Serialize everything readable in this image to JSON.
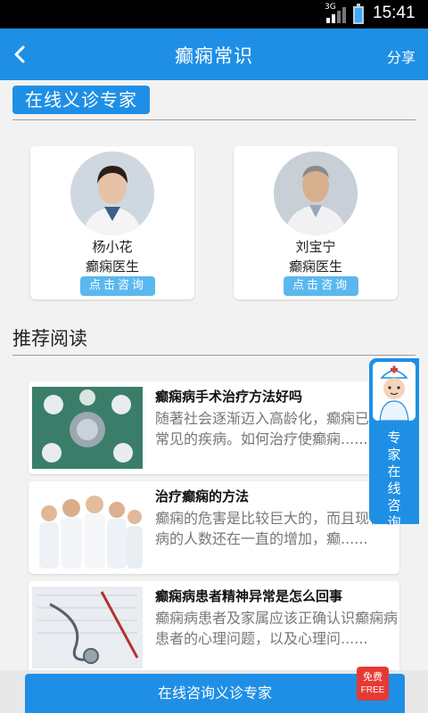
{
  "status_bar": {
    "network": "3G",
    "time": "15:41"
  },
  "app_bar": {
    "title": "癫痫常识",
    "share_label": "分享"
  },
  "experts_section": {
    "label": "在线义诊专家"
  },
  "doctors": [
    {
      "name": "杨小花",
      "role": "癫痫医生",
      "consult_label": "点击咨询"
    },
    {
      "name": "刘宝宁",
      "role": "癫痫医生",
      "consult_label": "点击咨询"
    }
  ],
  "reading_section": {
    "title": "推荐阅读"
  },
  "articles": [
    {
      "title": "癫痫病手术治疗方法好吗",
      "summary": "随著社会逐渐迈入高龄化，癫痫已成为常见的疾病。如何治疗使癫痫......"
    },
    {
      "title": "治疗癫痫的方法",
      "summary": "癫痫的危害是比较巨大的，而且现在患病的人数还在一直的增加，癫......"
    },
    {
      "title": "癫痫病患者精神异常是怎么回事",
      "summary": "癫痫病患者及家属应该正确认识癫痫病患者的心理问题，以及心理问......"
    }
  ],
  "side_widget": {
    "label": "专家在线咨询"
  },
  "bottom_button": {
    "label": "在线咨询义诊专家"
  },
  "free_badge": {
    "cn": "免费",
    "en": "FREE"
  },
  "colors": {
    "primary": "#1f8fe5",
    "consult": "#5bb8ef",
    "badge": "#e53935"
  }
}
